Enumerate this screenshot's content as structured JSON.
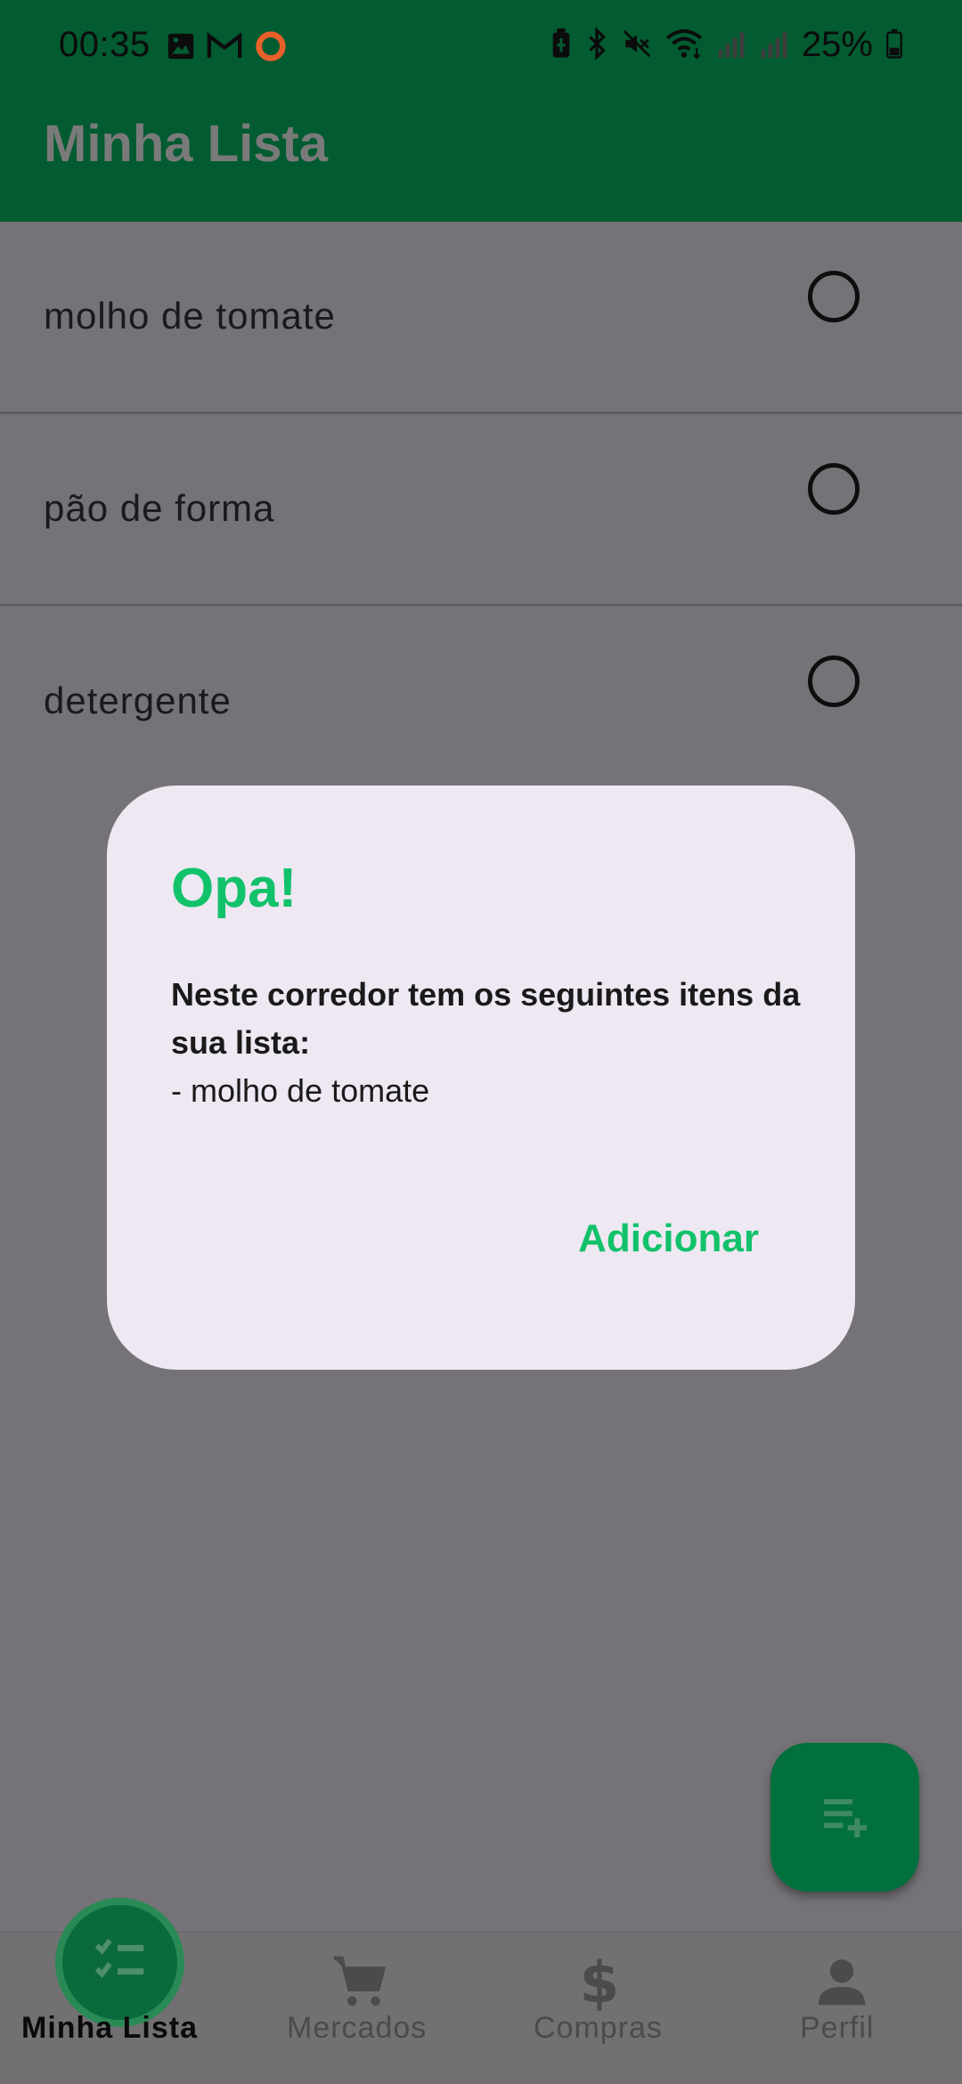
{
  "status_bar": {
    "time": "00:35",
    "battery_percent": "25%",
    "left_icons": [
      "gallery-icon",
      "gmail-icon",
      "ring-app-icon"
    ],
    "right_icons": [
      "battery-saver-icon",
      "bluetooth-icon",
      "mute-icon",
      "wifi-icon",
      "signal-icon",
      "signal-icon",
      "battery-icon"
    ]
  },
  "app_bar": {
    "title": "Minha Lista"
  },
  "list": {
    "items": [
      {
        "label": "molho de tomate"
      },
      {
        "label": "pão de forma"
      },
      {
        "label": "detergente"
      }
    ]
  },
  "dialog": {
    "title": "Opa!",
    "message_bold": "Neste corredor tem os seguintes itens da sua lista:",
    "message_item": "- molho de tomate",
    "action_label": "Adicionar"
  },
  "fab": {
    "icon": "playlist-add-icon"
  },
  "bottom_nav": {
    "items": [
      {
        "label": "Minha Lista",
        "icon": "checklist-icon",
        "active": true
      },
      {
        "label": "Mercados",
        "icon": "cart-icon",
        "active": false
      },
      {
        "label": "Compras",
        "icon": "dollar-icon",
        "active": false
      },
      {
        "label": "Perfil",
        "icon": "person-icon",
        "active": false
      }
    ]
  },
  "colors": {
    "app_bar": "#025b31",
    "scrim_content": "#757377",
    "dialog_bg": "#eee8f3",
    "accent_green": "#12c26a",
    "fab": "#02703c"
  }
}
